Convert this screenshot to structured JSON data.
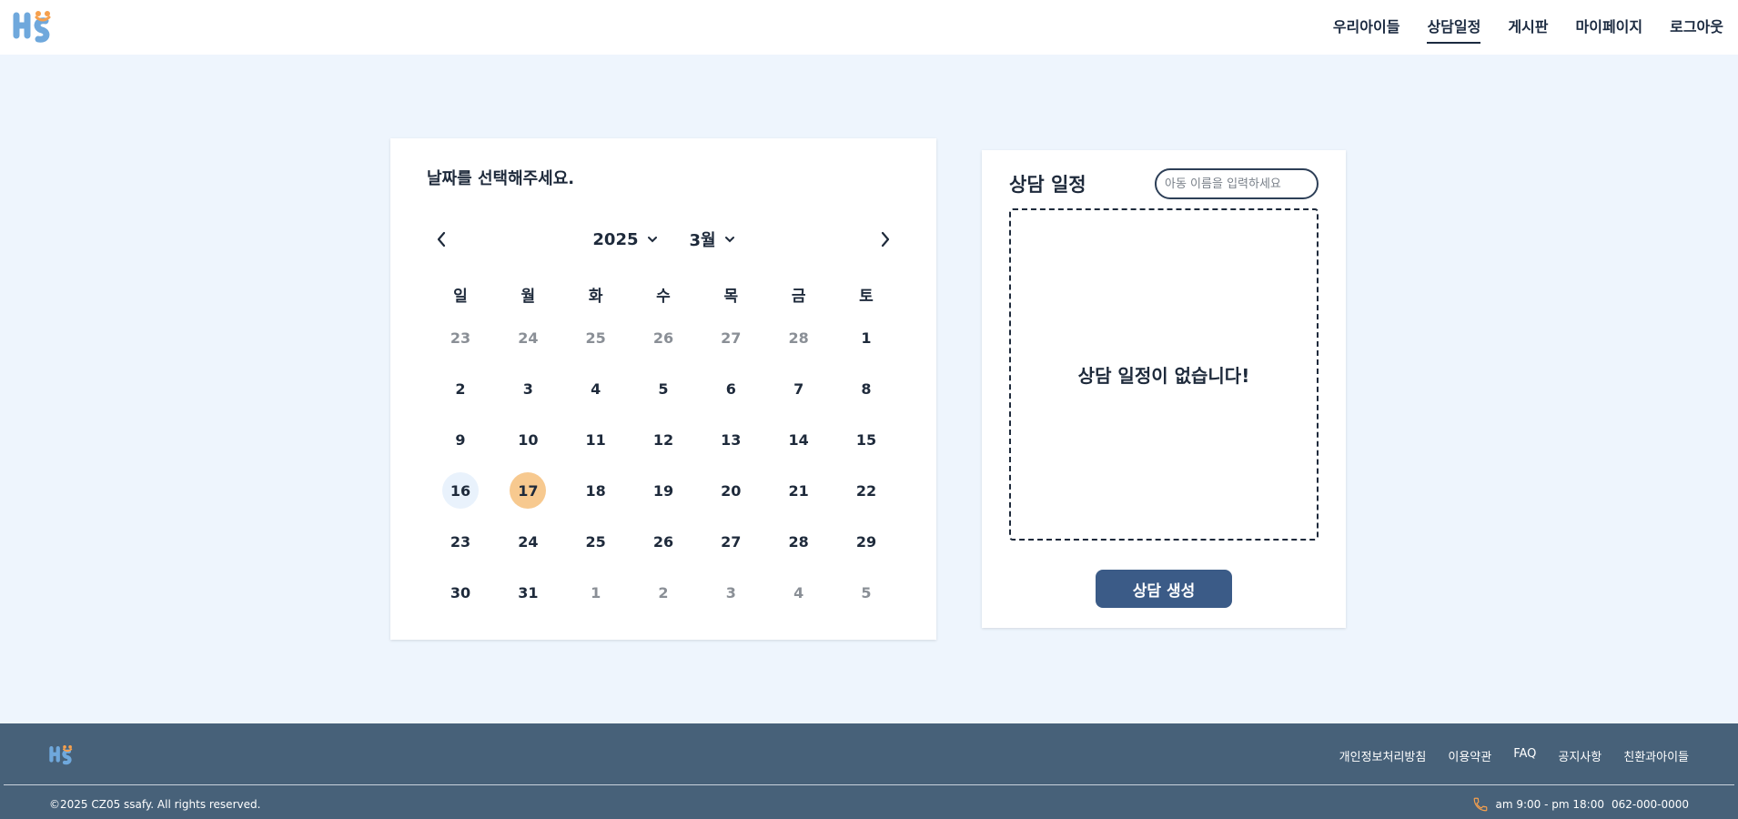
{
  "header": {
    "logo_alt": "HS",
    "nav": [
      {
        "label": "우리아이들",
        "active": false
      },
      {
        "label": "상담일정",
        "active": true
      },
      {
        "label": "게시판",
        "active": false
      },
      {
        "label": "마이페이지",
        "active": false
      },
      {
        "label": "로그아웃",
        "active": false
      }
    ]
  },
  "calendar": {
    "prompt": "날짜를 선택해주세요.",
    "year": "2025",
    "month": "3월",
    "prev_icon": "chevron-left-icon",
    "next_icon": "chevron-right-icon",
    "weekdays": [
      "일",
      "월",
      "화",
      "수",
      "목",
      "금",
      "토"
    ],
    "weeks": [
      [
        {
          "d": "23",
          "muted": true
        },
        {
          "d": "24",
          "muted": true
        },
        {
          "d": "25",
          "muted": true
        },
        {
          "d": "26",
          "muted": true
        },
        {
          "d": "27",
          "muted": true
        },
        {
          "d": "28",
          "muted": true
        },
        {
          "d": "1"
        }
      ],
      [
        {
          "d": "2"
        },
        {
          "d": "3"
        },
        {
          "d": "4"
        },
        {
          "d": "5"
        },
        {
          "d": "6"
        },
        {
          "d": "7"
        },
        {
          "d": "8"
        }
      ],
      [
        {
          "d": "9"
        },
        {
          "d": "10"
        },
        {
          "d": "11"
        },
        {
          "d": "12"
        },
        {
          "d": "13"
        },
        {
          "d": "14"
        },
        {
          "d": "15"
        }
      ],
      [
        {
          "d": "16",
          "today": true
        },
        {
          "d": "17",
          "selected": true
        },
        {
          "d": "18"
        },
        {
          "d": "19"
        },
        {
          "d": "20"
        },
        {
          "d": "21"
        },
        {
          "d": "22"
        }
      ],
      [
        {
          "d": "23"
        },
        {
          "d": "24"
        },
        {
          "d": "25"
        },
        {
          "d": "26"
        },
        {
          "d": "27"
        },
        {
          "d": "28"
        },
        {
          "d": "29"
        }
      ],
      [
        {
          "d": "30"
        },
        {
          "d": "31"
        },
        {
          "d": "1",
          "muted": true
        },
        {
          "d": "2",
          "muted": true
        },
        {
          "d": "3",
          "muted": true
        },
        {
          "d": "4",
          "muted": true
        },
        {
          "d": "5",
          "muted": true
        }
      ]
    ],
    "colors": {
      "selected": "#f7c98f",
      "today": "#e9f2fc"
    }
  },
  "consultation": {
    "title": "상담 일정",
    "search_placeholder": "아동 이름을 입력하세요",
    "empty_text": "상담 일정이 없습니다!",
    "create_button": "상담 생성"
  },
  "footer": {
    "links": [
      "개인정보처리방침",
      "이용약관",
      "FAQ",
      "공지사항",
      "친환과아이들"
    ],
    "copyright": "©2025 CZ05 ssafy. All rights reserved.",
    "hours": "am 9:00 - pm 18:00",
    "phone": "062-000-0000",
    "phone_icon": "phone-icon"
  },
  "theme": {
    "background": "#eef5fd",
    "footer_bg": "#476179",
    "primary": "#3b5b87",
    "accent": "#f6a04d",
    "logo_blue": "#6fa8dc"
  }
}
